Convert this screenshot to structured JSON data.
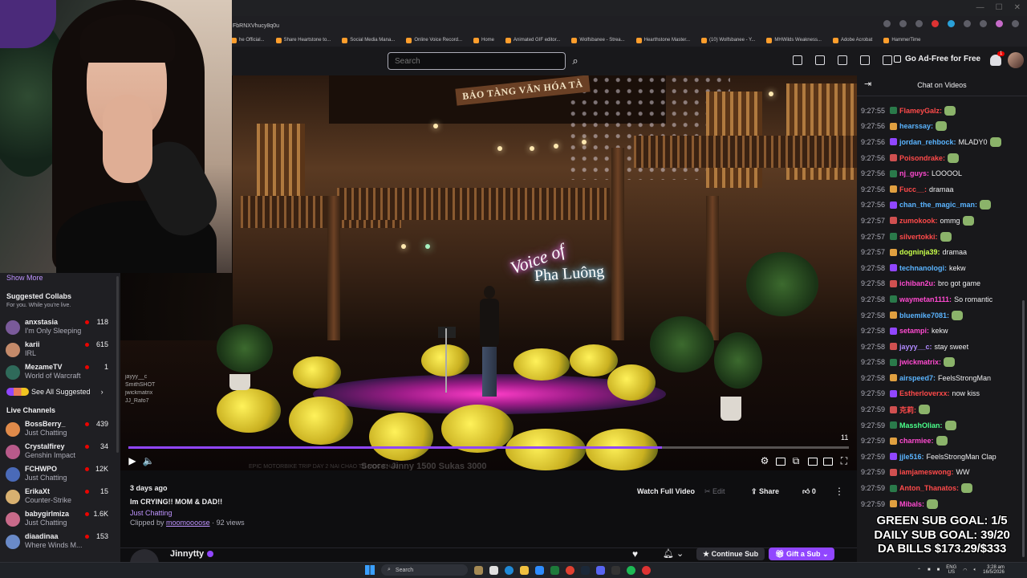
{
  "browser": {
    "url": "FbRNXVhucy8q0u",
    "bookmarks": [
      "he Official...",
      "Share Heartstone to...",
      "Social Media Mana...",
      "Online Voice Record...",
      "Home",
      "Animated GIF editor...",
      "Wolfsbanee - Strea...",
      "Hearthstone Master...",
      "(10) Wolfsbanee - Y...",
      "MHWilds Weakness...",
      "Adobe Acrobat",
      "HammerTime"
    ]
  },
  "header": {
    "search_placeholder": "Search",
    "ad_free_label": "Go Ad-Free for Free",
    "notification_count": "1"
  },
  "sidebar": {
    "show_more": "Show More",
    "suggested_title": "Suggested Collabs",
    "suggested_sub": "For you. While you're live.",
    "suggested": [
      {
        "name": "anxstasia",
        "game": "I'm Only Sleeping",
        "viewers": "118",
        "color": "#7a5a9a"
      },
      {
        "name": "karii",
        "game": "IRL",
        "viewers": "615",
        "color": "#c48a6a"
      },
      {
        "name": "MezameTV",
        "game": "World of Warcraft",
        "viewers": "1",
        "color": "#2f6a5a"
      }
    ],
    "see_all": "See All Suggested",
    "live_title": "Live Channels",
    "live": [
      {
        "name": "BossBerry_",
        "game": "Just Chatting",
        "viewers": "439",
        "color": "#e08a4a"
      },
      {
        "name": "Crystalfirey",
        "game": "Genshin Impact",
        "viewers": "34",
        "color": "#b85a8a"
      },
      {
        "name": "FCHWPO",
        "game": "Just Chatting",
        "viewers": "12K",
        "color": "#4a6ab8"
      },
      {
        "name": "ErikaXt",
        "game": "Counter-Strike",
        "viewers": "15",
        "color": "#d8b070"
      },
      {
        "name": "babygirlmiza",
        "game": "Just Chatting",
        "viewers": "1.6K",
        "color": "#c86a8a"
      },
      {
        "name": "diaadinaa",
        "game": "Where Winds M...",
        "viewers": "153",
        "color": "#6a8ac8"
      }
    ]
  },
  "video": {
    "sign_text": "BẢO TÀNG VĂN HÓA TÀ",
    "neon_line1": "Voice of",
    "neon_line2": "Pha Luông",
    "progress": 0.74,
    "overlay_count": "11",
    "overlay_text": "Score: Jinny 1500 Sukas 3000",
    "overlay_left": "EPIC MOTORBIKE TRIP DAY 2 NAI CHAO TO MOC CHAU",
    "chat_overlay": [
      "jayyy__c",
      "SmithSHOT",
      "jwickmatrix",
      "JJ_Rafo7"
    ]
  },
  "clip": {
    "date": "3 days ago",
    "title": "Im CRYING!! MOM & DAD!!",
    "category": "Just Chatting",
    "clipped_by_prefix": "Clipped by",
    "clipper": "moomoooose",
    "views": "· 92 views",
    "watch_full": "Watch Full Video",
    "edit": "Edit",
    "share": "Share",
    "likes": "0",
    "channel": "Jinnytty",
    "continue_sub": "Continue Sub",
    "gift_sub": "Gift a Sub"
  },
  "chat": {
    "title": "Chat on Videos",
    "messages": [
      {
        "ts": "9:27:55",
        "user": "FlameyGalz:",
        "text": "",
        "color": "#ff4a4a",
        "emote": true
      },
      {
        "ts": "9:27:56",
        "user": "hearssay:",
        "text": "",
        "color": "#5ab4ff",
        "emote": true
      },
      {
        "ts": "9:27:56",
        "user": "jordan_rehbock:",
        "text": "MLADY0",
        "color": "#5ab4ff",
        "emote": true
      },
      {
        "ts": "9:27:56",
        "user": "Poisondrake:",
        "text": "",
        "color": "#ff4a4a",
        "emote": true
      },
      {
        "ts": "9:27:56",
        "user": "nj_guys:",
        "text": "LOOOOL",
        "color": "#ff4ad0",
        "emote": false
      },
      {
        "ts": "9:27:56",
        "user": "Fucc__:",
        "text": "dramaa",
        "color": "#ff4a4a",
        "emote": false
      },
      {
        "ts": "9:27:56",
        "user": "chan_the_magic_man:",
        "text": "",
        "color": "#5ab4ff",
        "emote": true
      },
      {
        "ts": "9:27:57",
        "user": "zumokook:",
        "text": "ommg",
        "color": "#ff4a4a",
        "emote": true
      },
      {
        "ts": "9:27:57",
        "user": "silvertokki:",
        "text": "",
        "color": "#ff4a4a",
        "emote": true
      },
      {
        "ts": "9:27:57",
        "user": "dogninja39:",
        "text": "dramaa",
        "color": "#c8ff4a",
        "emote": false
      },
      {
        "ts": "9:27:58",
        "user": "technanologi:",
        "text": "kekw",
        "color": "#5ab4ff",
        "emote": false
      },
      {
        "ts": "9:27:58",
        "user": "ichiban2u:",
        "text": "bro got game",
        "color": "#ff4ad0",
        "emote": false
      },
      {
        "ts": "9:27:58",
        "user": "waymetan1111:",
        "text": "So romantic",
        "color": "#ff4ad0",
        "emote": false
      },
      {
        "ts": "9:27:58",
        "user": "bluemike7081:",
        "text": "",
        "color": "#5ab4ff",
        "emote": true
      },
      {
        "ts": "9:27:58",
        "user": "setampi:",
        "text": "kekw",
        "color": "#ff4ad0",
        "emote": false
      },
      {
        "ts": "9:27:58",
        "user": "jayyy__c:",
        "text": "stay sweet",
        "color": "#b08aff",
        "emote": false
      },
      {
        "ts": "9:27:58",
        "user": "jwickmatrix:",
        "text": "",
        "color": "#ff4ad0",
        "emote": true
      },
      {
        "ts": "9:27:58",
        "user": "airspeed7:",
        "text": "FeelsStrongMan",
        "color": "#5ab4ff",
        "emote": false
      },
      {
        "ts": "9:27:59",
        "user": "Estherloverxx:",
        "text": "now kiss",
        "color": "#ff4a4a",
        "emote": false
      },
      {
        "ts": "9:27:59",
        "user": "克莉:",
        "text": "",
        "color": "#ff4a4a",
        "emote": true
      },
      {
        "ts": "9:27:59",
        "user": "MasshOlian:",
        "text": "",
        "color": "#4aff8a",
        "emote": true
      },
      {
        "ts": "9:27:59",
        "user": "charmiee:",
        "text": "",
        "color": "#ff4ad0",
        "emote": true
      },
      {
        "ts": "9:27:59",
        "user": "jjle516:",
        "text": "FeelsStrongMan Clap",
        "color": "#5ab4ff",
        "emote": false
      },
      {
        "ts": "9:27:59",
        "user": "iamjameswong:",
        "text": "WW",
        "color": "#ff4a4a",
        "emote": false
      },
      {
        "ts": "9:27:59",
        "user": "Anton_Thanatos:",
        "text": "",
        "color": "#ff4a4a",
        "emote": true
      },
      {
        "ts": "9:27:59",
        "user": "Mibals:",
        "text": "",
        "color": "#ff4ad0",
        "emote": true
      }
    ]
  },
  "goals": [
    "GREEN SUB GOAL: 1/5",
    "DAILY SUB GOAL: 39/20",
    "DA BILLS $173.29/$333"
  ],
  "taskbar": {
    "search": "Search",
    "lang1": "ENG",
    "lang2": "US",
    "time": "3:28 am",
    "date": "16/5/2026"
  }
}
